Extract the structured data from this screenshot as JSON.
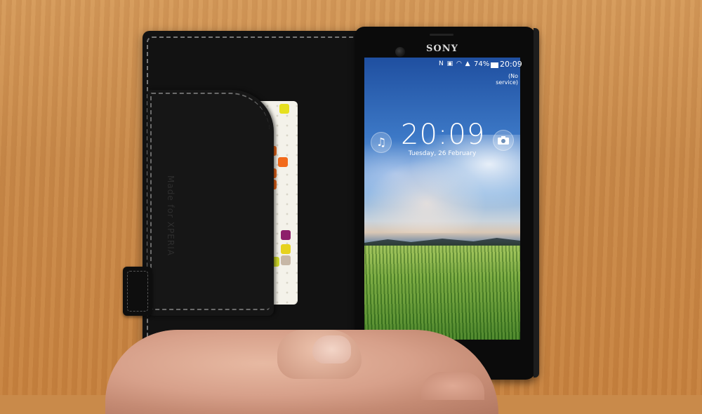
{
  "phone": {
    "brand": "SONY",
    "status_bar": {
      "icons": "N ▣ ◠ ▲",
      "battery": "74%",
      "time": "20:09"
    },
    "carrier": "(No service)",
    "lockscreen": {
      "clock": "20:09",
      "date": "Tuesday, 26 February",
      "left_button": "music-icon",
      "right_button": "camera-icon"
    }
  },
  "wallet_case": {
    "embossed_text": "Made for XPERIA",
    "card_colors": [
      "#f26a1b",
      "#f6a323",
      "#8d1f6a",
      "#e6d21e",
      "#c7b7a6",
      "#cfd82c"
    ]
  }
}
